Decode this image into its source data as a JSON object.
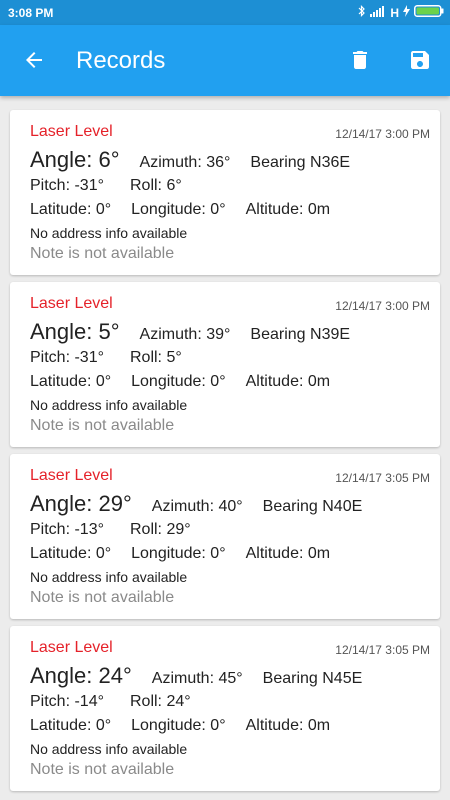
{
  "status_bar": {
    "time": "3:08 PM",
    "network": "H",
    "icons": [
      "bluetooth-icon",
      "signal-icon",
      "charging-icon",
      "battery-icon"
    ]
  },
  "app_bar": {
    "title": "Records",
    "back_icon": "arrow-back-icon",
    "delete_icon": "trash-icon",
    "save_icon": "save-icon"
  },
  "colors": {
    "status_bar": "#1d8fd4",
    "app_bar": "#21a0f0",
    "record_title": "#e5222a",
    "note": "#8a8a8a",
    "background": "#ececec"
  },
  "records": [
    {
      "title": "Laser Level",
      "date": "12/14/17 3:00 PM",
      "angle": "Angle: 6°",
      "azimuth": "Azimuth: 36°",
      "bearing": "Bearing N36E",
      "pitch": "Pitch: -31°",
      "roll": "Roll: 6°",
      "latitude": "Latitude: 0°",
      "longitude": "Longitude: 0°",
      "altitude": "Altitude: 0m",
      "address": "No address info available",
      "note": "Note is not available"
    },
    {
      "title": "Laser Level",
      "date": "12/14/17 3:00 PM",
      "angle": "Angle: 5°",
      "azimuth": "Azimuth: 39°",
      "bearing": "Bearing N39E",
      "pitch": "Pitch: -31°",
      "roll": "Roll: 5°",
      "latitude": "Latitude: 0°",
      "longitude": "Longitude: 0°",
      "altitude": "Altitude: 0m",
      "address": "No address info available",
      "note": "Note is not available"
    },
    {
      "title": "Laser Level",
      "date": "12/14/17 3:05 PM",
      "angle": "Angle: 29°",
      "azimuth": "Azimuth: 40°",
      "bearing": "Bearing N40E",
      "pitch": "Pitch: -13°",
      "roll": "Roll: 29°",
      "latitude": "Latitude: 0°",
      "longitude": "Longitude: 0°",
      "altitude": "Altitude: 0m",
      "address": "No address info available",
      "note": "Note is not available"
    },
    {
      "title": "Laser Level",
      "date": "12/14/17 3:05 PM",
      "angle": "Angle: 24°",
      "azimuth": "Azimuth: 45°",
      "bearing": "Bearing N45E",
      "pitch": "Pitch: -14°",
      "roll": "Roll: 24°",
      "latitude": "Latitude: 0°",
      "longitude": "Longitude: 0°",
      "altitude": "Altitude: 0m",
      "address": "No address info available",
      "note": "Note is not available"
    }
  ]
}
